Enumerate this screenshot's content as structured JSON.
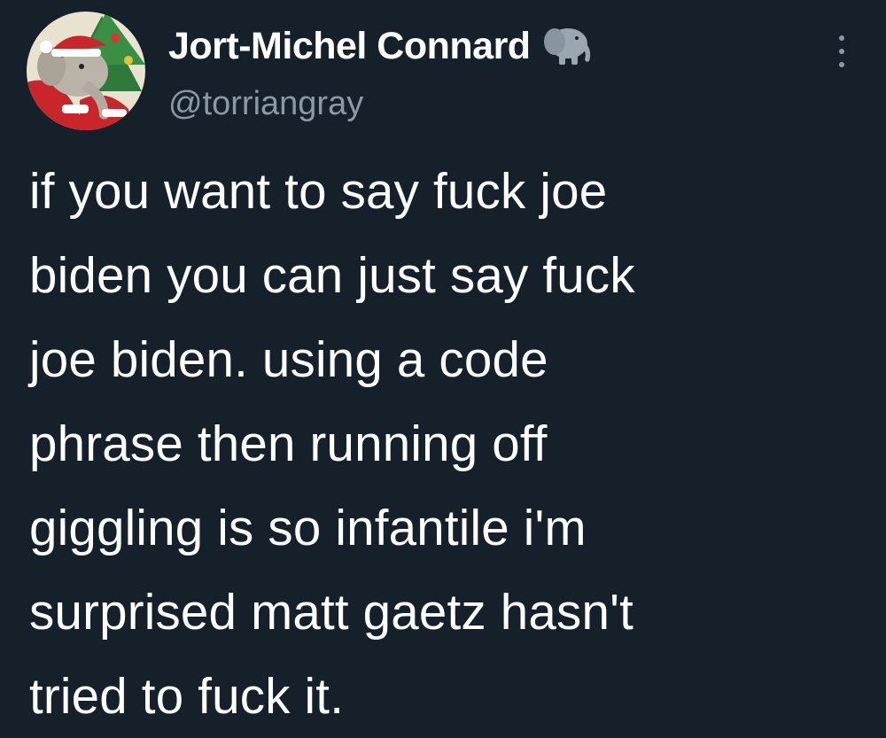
{
  "author": {
    "display_name": "Jort-Michel Connard",
    "handle": "@torriangray",
    "name_emoji_icon": "elephant-icon",
    "avatar_icon": "elephant-santa-avatar"
  },
  "tweet": {
    "text": "if you want to say fuck joe\nbiden you can just say fuck\njoe biden. using a code\nphrase then running off\ngiggling is so infantile i'm\nsurprised matt gaetz hasn't\ntried to fuck it."
  },
  "menu": {
    "more_icon": "more-options-icon"
  },
  "colors": {
    "background": "#15202b",
    "text": "#ffffff",
    "secondary_text": "#8b98a5"
  }
}
